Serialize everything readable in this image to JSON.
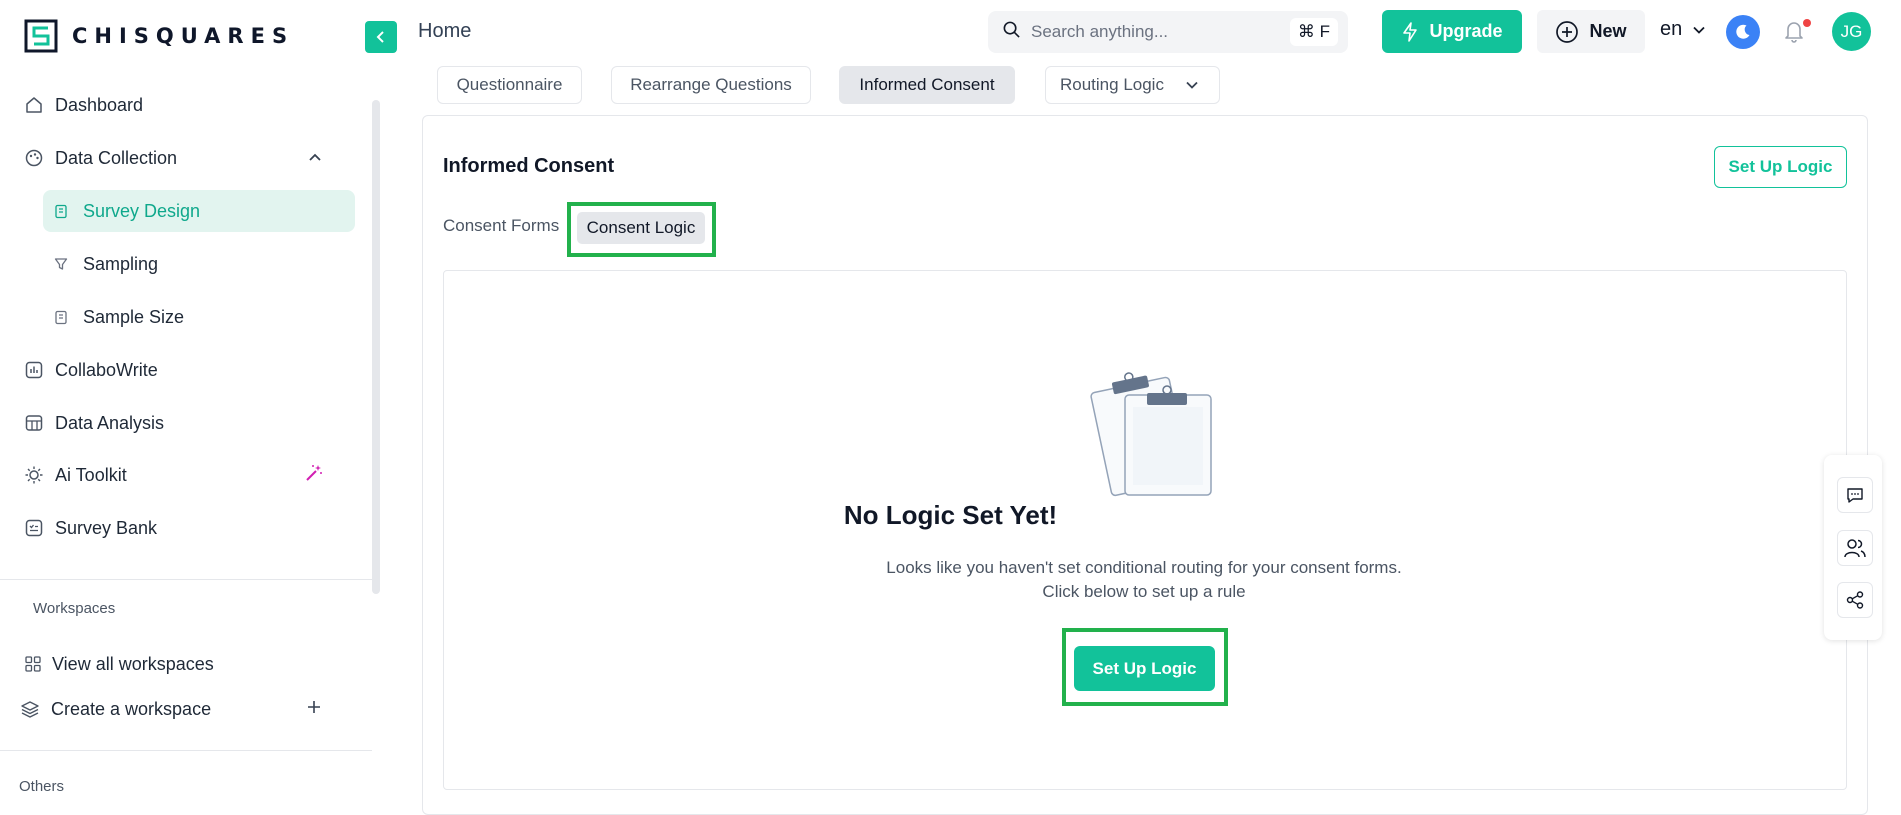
{
  "app": {
    "brand": "CHISQUARES"
  },
  "header": {
    "title": "Home",
    "search_placeholder": "Search anything...",
    "search_shortcut": "⌘ F",
    "upgrade_label": "Upgrade",
    "new_label": "New",
    "language": "en",
    "avatar_initials": "JG"
  },
  "sidebar": {
    "items": [
      {
        "label": "Dashboard",
        "icon": "home-icon"
      },
      {
        "label": "Data Collection",
        "icon": "palette-icon",
        "expanded": true
      },
      {
        "label": "Survey Design",
        "icon": "clipboard-icon",
        "active": true
      },
      {
        "label": "Sampling",
        "icon": "filter-icon"
      },
      {
        "label": "Sample Size",
        "icon": "clipboard-icon"
      },
      {
        "label": "CollaboWrite",
        "icon": "chart-box-icon"
      },
      {
        "label": "Data Analysis",
        "icon": "table-icon"
      },
      {
        "label": "Ai Toolkit",
        "icon": "sun-gear-icon"
      },
      {
        "label": "Survey Bank",
        "icon": "list-box-icon"
      }
    ],
    "workspaces_heading": "Workspaces",
    "view_workspaces": "View all workspaces",
    "create_workspace": "Create a workspace",
    "others_heading": "Others"
  },
  "tabs": [
    {
      "label": "Questionnaire"
    },
    {
      "label": "Rearrange Questions"
    },
    {
      "label": "Informed Consent",
      "active": true
    },
    {
      "label": "Routing Logic"
    }
  ],
  "card": {
    "title": "Informed Consent",
    "setup_logic_label": "Set Up Logic",
    "subtabs": [
      "Consent Forms",
      "Consent Logic"
    ],
    "empty": {
      "title": "No Logic Set Yet!",
      "line1": "Looks like you haven't set conditional routing for your consent forms.",
      "line2": "Click below to set up a rule",
      "button": "Set Up Logic"
    }
  },
  "colors": {
    "accent": "#12c29a",
    "highlight": "#22b14c",
    "active_bg": "#e2f4ef"
  }
}
